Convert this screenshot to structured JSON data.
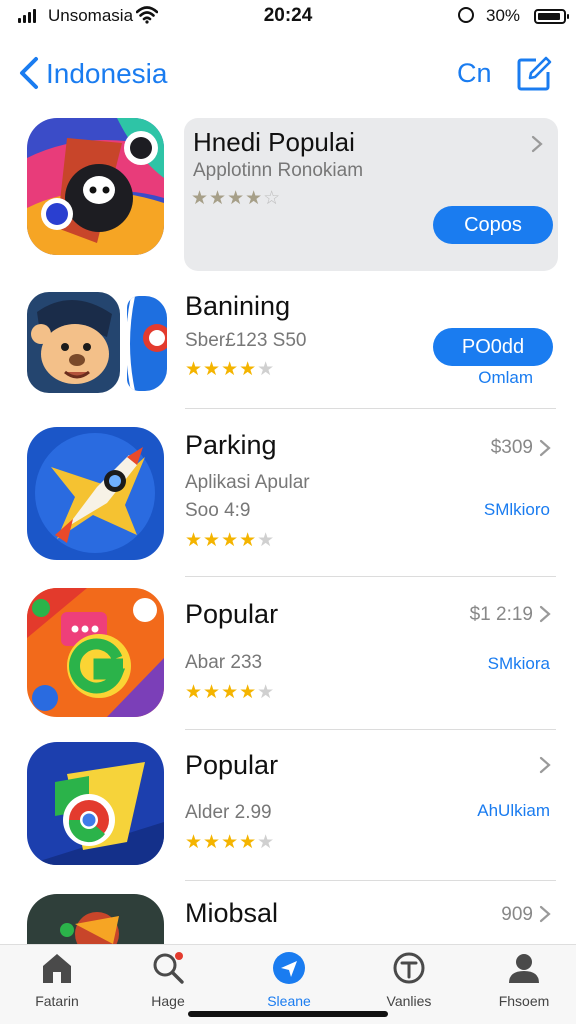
{
  "status_bar": {
    "carrier": "Unsomasia",
    "time": "20:24",
    "battery": "30%"
  },
  "nav": {
    "back_label": "Indonesia",
    "right_label": "Cn"
  },
  "featured": {
    "title": "Hnedi Populai",
    "subtitle": "Applotinn Ronokiam",
    "rating": 3.5,
    "button_label": "Copos"
  },
  "apps": [
    {
      "title": "Banining",
      "subtitle": "Sber£123 S50",
      "rating": 4,
      "button_label": "PO0dd",
      "link": "Omlam"
    },
    {
      "title": "Parking",
      "subtitle": "Aplikasi Apular",
      "subtitle2": "Soo 4:9",
      "rating": 4,
      "price": "$309",
      "link": "SMlkioro"
    },
    {
      "title": "Popular",
      "subtitle": "Abar 233",
      "rating": 4,
      "price": "$1 2:19",
      "link": "SMkiora"
    },
    {
      "title": "Popular",
      "subtitle": "Alder 2.99",
      "rating": 4,
      "link": "AhUlkiam"
    },
    {
      "title": "Miobsal",
      "price": "909"
    }
  ],
  "icons": {
    "back": "chevron-left-icon",
    "compose": "compose-icon",
    "wifi": "wifi-icon",
    "lock": "rotation-lock-icon",
    "battery": "battery-icon"
  },
  "tabs": [
    {
      "label": "Fatarin",
      "icon": "home-icon"
    },
    {
      "label": "Hage",
      "icon": "search-icon"
    },
    {
      "label": "Sleane",
      "icon": "location-icon",
      "active": true
    },
    {
      "label": "Vanlies",
      "icon": "updates-icon"
    },
    {
      "label": "Fhsoem",
      "icon": "profile-icon"
    }
  ],
  "colors": {
    "accent": "#1a7cf0",
    "star": "#f4b400",
    "card_bg": "#e9eaec"
  }
}
